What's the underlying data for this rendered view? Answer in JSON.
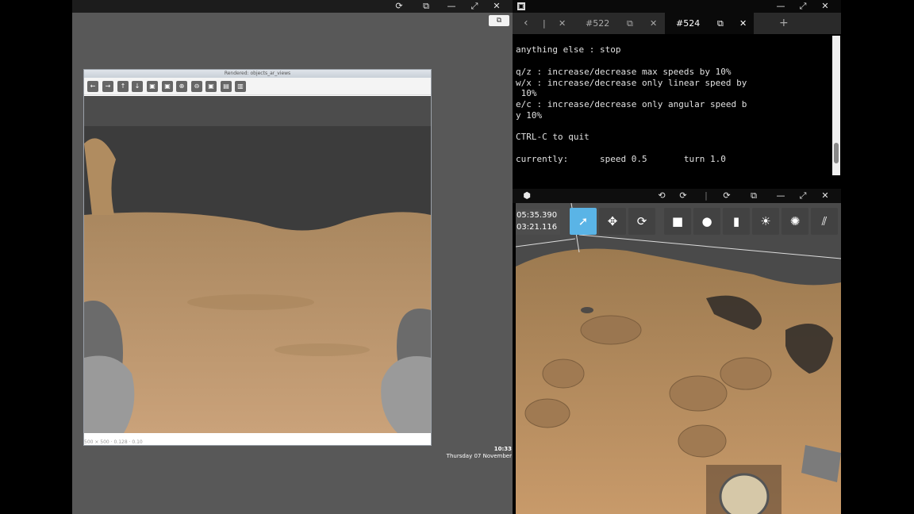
{
  "left_topbar": {
    "icons": [
      "refresh-icon",
      "external-link-icon",
      "minimize-icon",
      "maximize-icon",
      "close-icon"
    ],
    "glyphs": [
      "⟳",
      "⧉",
      "—",
      "⤢",
      "✕"
    ]
  },
  "float_button": {
    "glyph": "⧉"
  },
  "viewer": {
    "title": "Rendered: objects_ar_views",
    "toolbar_glyphs": [
      "←",
      "→",
      "↑",
      "↓",
      "▣",
      "▣",
      "⊕",
      "⊖",
      "▣",
      "▤",
      "▥"
    ],
    "status": "500 × 500 · 0.128 · 0.10"
  },
  "clock": {
    "time": "10:33",
    "date": "Thursday 07 November"
  },
  "terminal": {
    "tab_back": "‹",
    "tab_sep": "|",
    "tab_close": "✕",
    "tabs": [
      {
        "label": "#522"
      },
      {
        "label": "#524"
      }
    ],
    "tab_add": "+",
    "window_glyphs": [
      "—",
      "⤢",
      "✕"
    ],
    "lines": [
      "anything else : stop",
      "",
      "q/z : increase/decrease max speeds by 10%",
      "w/x : increase/decrease only linear speed by",
      " 10%",
      "e/c : increase/decrease only angular speed b",
      "y 10%",
      "",
      "CTRL-C to quit",
      "",
      "currently:\tspeed 0.5\tturn 1.0"
    ]
  },
  "gazebo": {
    "titlebar_glyphs": [
      "⟲",
      "⟳",
      "|",
      "⟳",
      "⧉",
      "—",
      "⤢",
      "✕"
    ],
    "sim_time": "05:35.390",
    "real_time": "03:21.116",
    "tools": [
      {
        "name": "select-tool",
        "glyph": "➚",
        "active": true
      },
      {
        "name": "translate-tool",
        "glyph": "✥",
        "active": false
      },
      {
        "name": "rotate-tool",
        "glyph": "⟳",
        "active": false
      },
      {
        "name": "box-tool",
        "glyph": "■",
        "active": false
      },
      {
        "name": "sphere-tool",
        "glyph": "●",
        "active": false
      },
      {
        "name": "cylinder-tool",
        "glyph": "▮",
        "active": false
      },
      {
        "name": "sun-light-tool",
        "glyph": "☀",
        "active": false
      },
      {
        "name": "point-light-tool",
        "glyph": "✺",
        "active": false
      },
      {
        "name": "directional-light-tool",
        "glyph": "⫽",
        "active": false
      }
    ],
    "accent": "#5ab4e6"
  }
}
